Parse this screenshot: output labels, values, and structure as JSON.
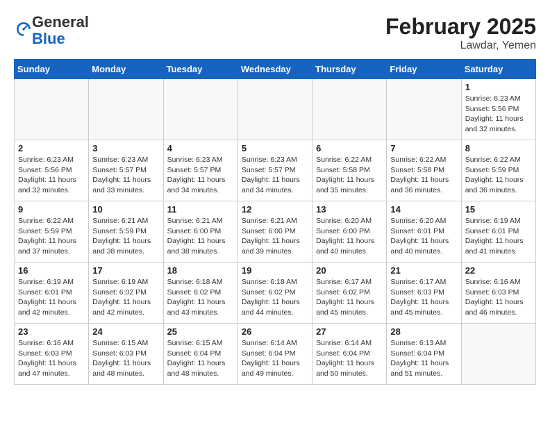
{
  "logo": {
    "general": "General",
    "blue": "Blue"
  },
  "title": "February 2025",
  "location": "Lawdar, Yemen",
  "days_of_week": [
    "Sunday",
    "Monday",
    "Tuesday",
    "Wednesday",
    "Thursday",
    "Friday",
    "Saturday"
  ],
  "weeks": [
    [
      {
        "day": "",
        "info": ""
      },
      {
        "day": "",
        "info": ""
      },
      {
        "day": "",
        "info": ""
      },
      {
        "day": "",
        "info": ""
      },
      {
        "day": "",
        "info": ""
      },
      {
        "day": "",
        "info": ""
      },
      {
        "day": "1",
        "info": "Sunrise: 6:23 AM\nSunset: 5:56 PM\nDaylight: 11 hours\nand 32 minutes."
      }
    ],
    [
      {
        "day": "2",
        "info": "Sunrise: 6:23 AM\nSunset: 5:56 PM\nDaylight: 11 hours\nand 32 minutes."
      },
      {
        "day": "3",
        "info": "Sunrise: 6:23 AM\nSunset: 5:57 PM\nDaylight: 11 hours\nand 33 minutes."
      },
      {
        "day": "4",
        "info": "Sunrise: 6:23 AM\nSunset: 5:57 PM\nDaylight: 11 hours\nand 34 minutes."
      },
      {
        "day": "5",
        "info": "Sunrise: 6:23 AM\nSunset: 5:57 PM\nDaylight: 11 hours\nand 34 minutes."
      },
      {
        "day": "6",
        "info": "Sunrise: 6:22 AM\nSunset: 5:58 PM\nDaylight: 11 hours\nand 35 minutes."
      },
      {
        "day": "7",
        "info": "Sunrise: 6:22 AM\nSunset: 5:58 PM\nDaylight: 11 hours\nand 36 minutes."
      },
      {
        "day": "8",
        "info": "Sunrise: 6:22 AM\nSunset: 5:59 PM\nDaylight: 11 hours\nand 36 minutes."
      }
    ],
    [
      {
        "day": "9",
        "info": "Sunrise: 6:22 AM\nSunset: 5:59 PM\nDaylight: 11 hours\nand 37 minutes."
      },
      {
        "day": "10",
        "info": "Sunrise: 6:21 AM\nSunset: 5:59 PM\nDaylight: 11 hours\nand 38 minutes."
      },
      {
        "day": "11",
        "info": "Sunrise: 6:21 AM\nSunset: 6:00 PM\nDaylight: 11 hours\nand 38 minutes."
      },
      {
        "day": "12",
        "info": "Sunrise: 6:21 AM\nSunset: 6:00 PM\nDaylight: 11 hours\nand 39 minutes."
      },
      {
        "day": "13",
        "info": "Sunrise: 6:20 AM\nSunset: 6:00 PM\nDaylight: 11 hours\nand 40 minutes."
      },
      {
        "day": "14",
        "info": "Sunrise: 6:20 AM\nSunset: 6:01 PM\nDaylight: 11 hours\nand 40 minutes."
      },
      {
        "day": "15",
        "info": "Sunrise: 6:19 AM\nSunset: 6:01 PM\nDaylight: 11 hours\nand 41 minutes."
      }
    ],
    [
      {
        "day": "16",
        "info": "Sunrise: 6:19 AM\nSunset: 6:01 PM\nDaylight: 11 hours\nand 42 minutes."
      },
      {
        "day": "17",
        "info": "Sunrise: 6:19 AM\nSunset: 6:02 PM\nDaylight: 11 hours\nand 42 minutes."
      },
      {
        "day": "18",
        "info": "Sunrise: 6:18 AM\nSunset: 6:02 PM\nDaylight: 11 hours\nand 43 minutes."
      },
      {
        "day": "19",
        "info": "Sunrise: 6:18 AM\nSunset: 6:02 PM\nDaylight: 11 hours\nand 44 minutes."
      },
      {
        "day": "20",
        "info": "Sunrise: 6:17 AM\nSunset: 6:02 PM\nDaylight: 11 hours\nand 45 minutes."
      },
      {
        "day": "21",
        "info": "Sunrise: 6:17 AM\nSunset: 6:03 PM\nDaylight: 11 hours\nand 45 minutes."
      },
      {
        "day": "22",
        "info": "Sunrise: 6:16 AM\nSunset: 6:03 PM\nDaylight: 11 hours\nand 46 minutes."
      }
    ],
    [
      {
        "day": "23",
        "info": "Sunrise: 6:16 AM\nSunset: 6:03 PM\nDaylight: 11 hours\nand 47 minutes."
      },
      {
        "day": "24",
        "info": "Sunrise: 6:15 AM\nSunset: 6:03 PM\nDaylight: 11 hours\nand 48 minutes."
      },
      {
        "day": "25",
        "info": "Sunrise: 6:15 AM\nSunset: 6:04 PM\nDaylight: 11 hours\nand 48 minutes."
      },
      {
        "day": "26",
        "info": "Sunrise: 6:14 AM\nSunset: 6:04 PM\nDaylight: 11 hours\nand 49 minutes."
      },
      {
        "day": "27",
        "info": "Sunrise: 6:14 AM\nSunset: 6:04 PM\nDaylight: 11 hours\nand 50 minutes."
      },
      {
        "day": "28",
        "info": "Sunrise: 6:13 AM\nSunset: 6:04 PM\nDaylight: 11 hours\nand 51 minutes."
      },
      {
        "day": "",
        "info": ""
      }
    ]
  ]
}
